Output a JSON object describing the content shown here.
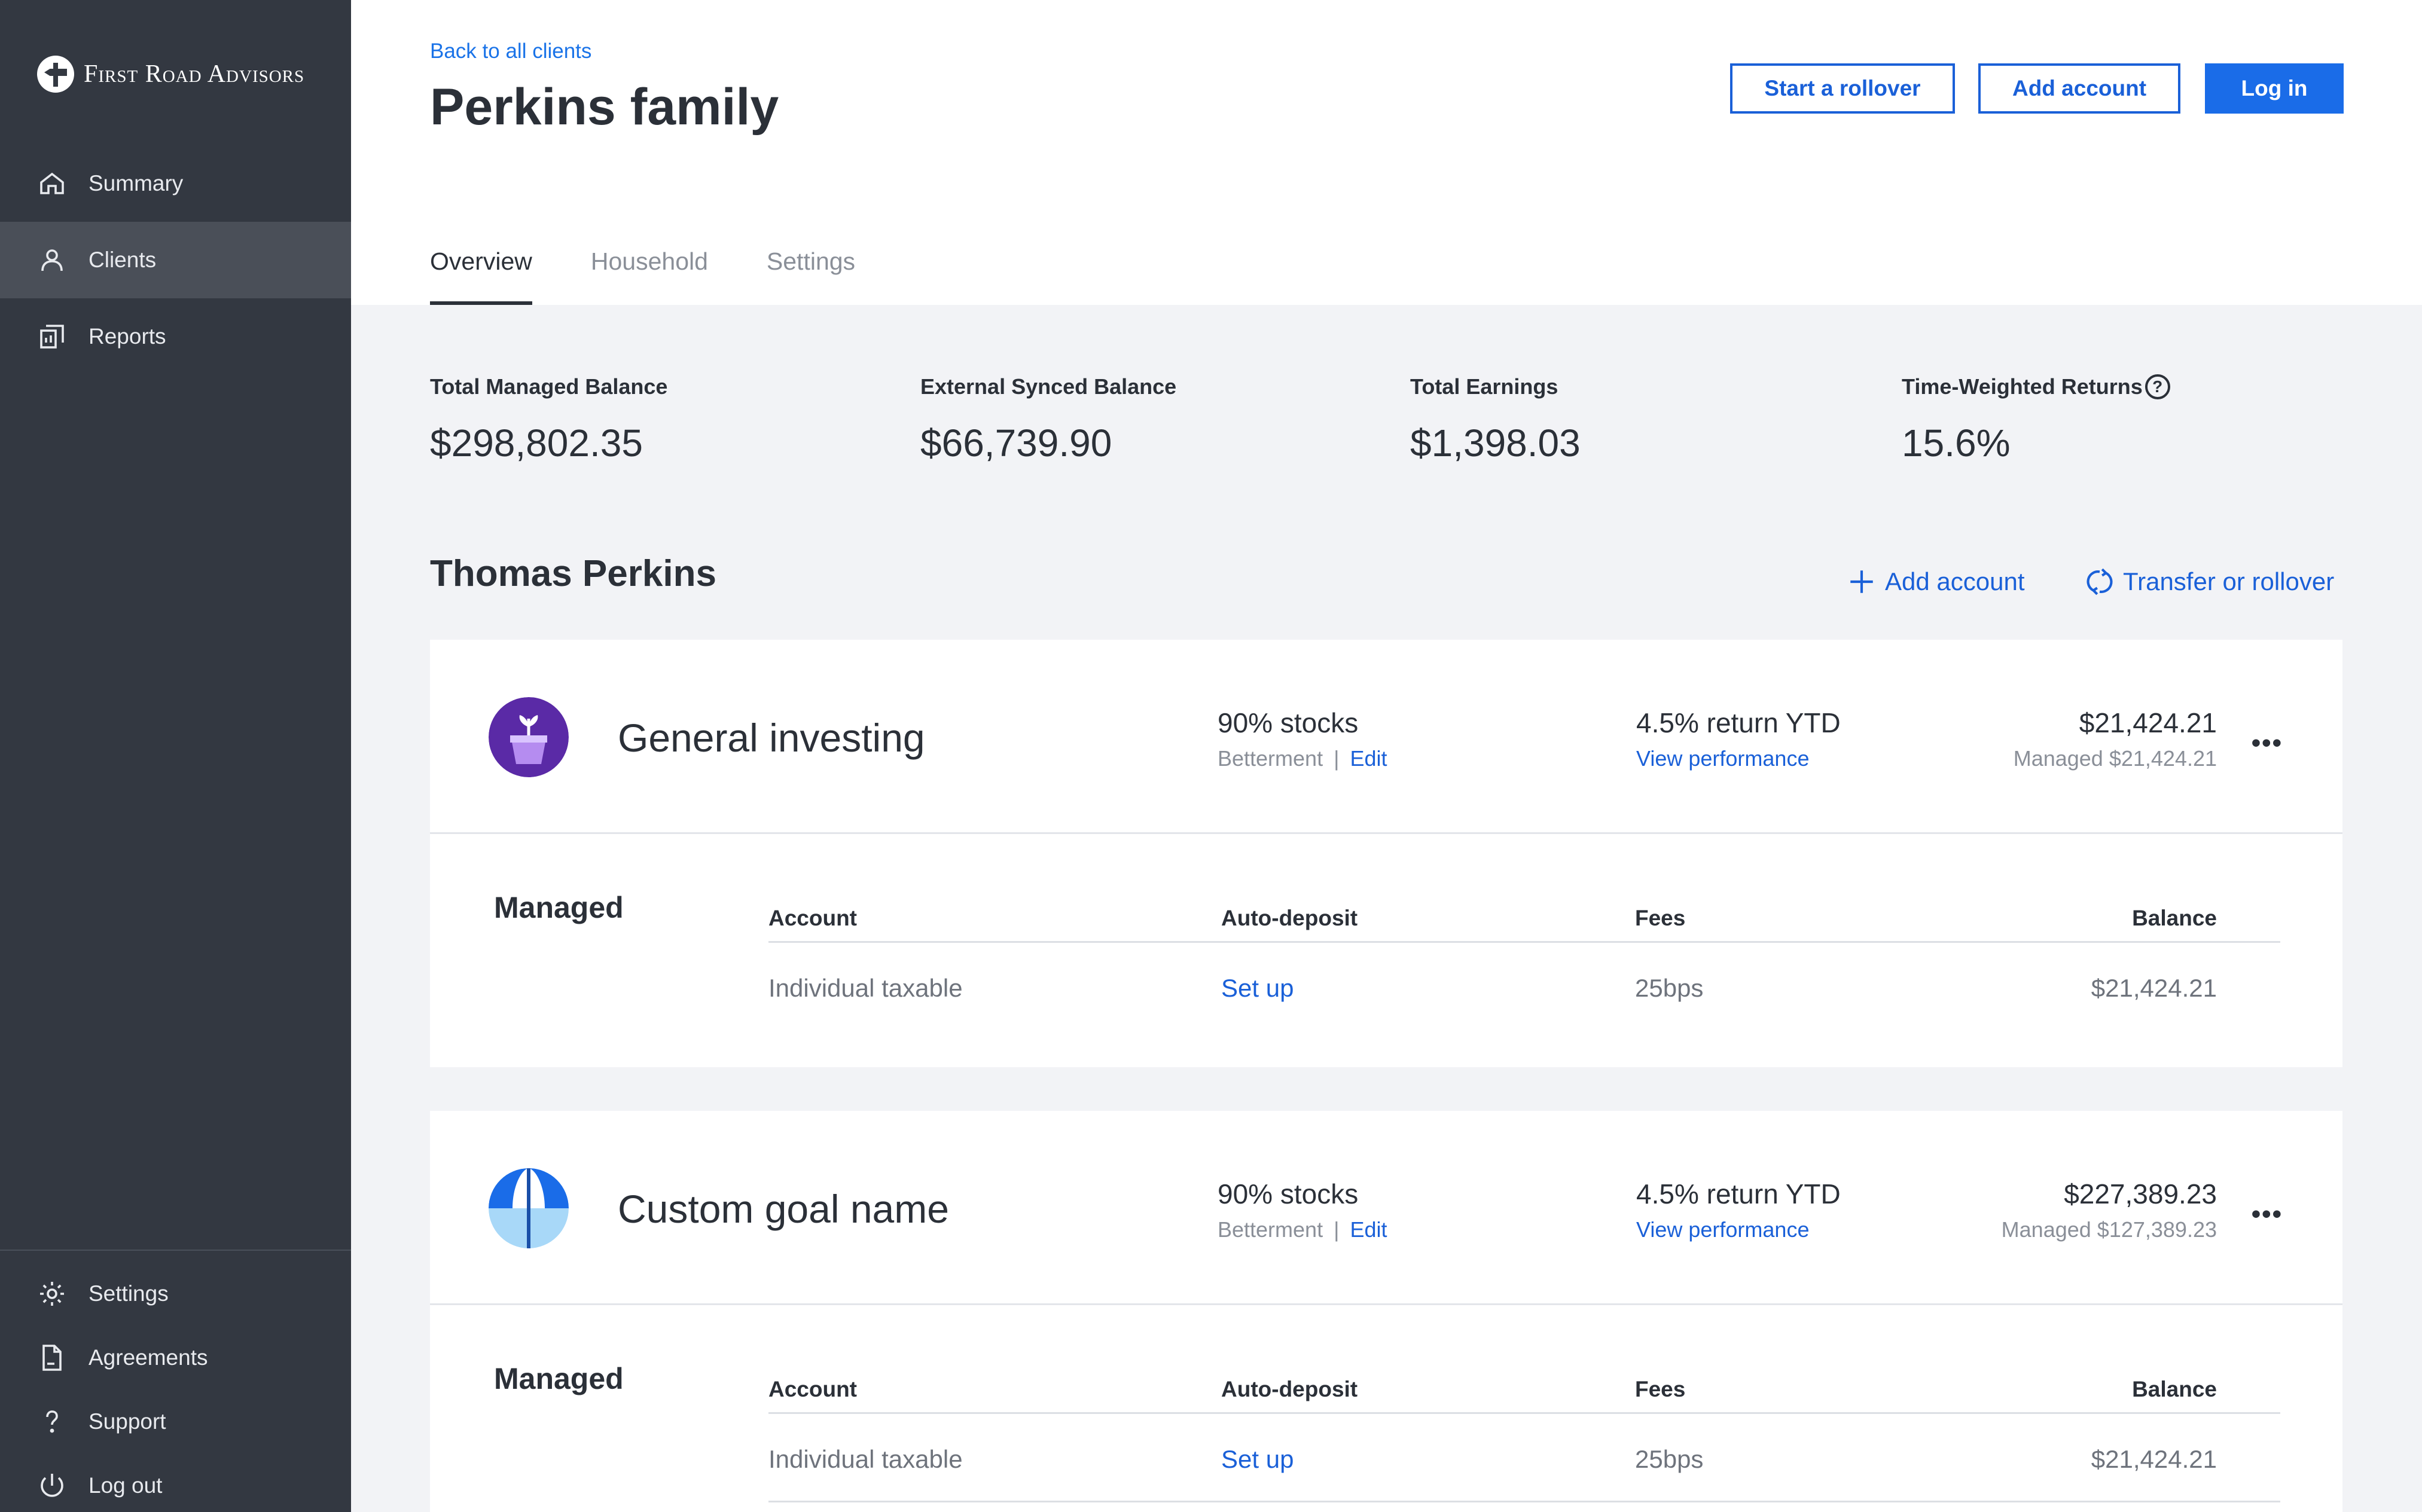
{
  "brand": {
    "name": "First Road Advisors"
  },
  "nav": {
    "top": [
      {
        "label": "Summary",
        "icon": "home-icon"
      },
      {
        "label": "Clients",
        "icon": "person-icon",
        "active": true
      },
      {
        "label": "Reports",
        "icon": "reports-icon"
      }
    ],
    "bottom": [
      {
        "label": "Settings",
        "icon": "gear-icon"
      },
      {
        "label": "Agreements",
        "icon": "document-icon"
      },
      {
        "label": "Support",
        "icon": "question-icon"
      },
      {
        "label": "Log out",
        "icon": "power-icon"
      }
    ]
  },
  "header": {
    "back_link": "Back to all clients",
    "title": "Perkins family",
    "buttons": {
      "rollover": "Start a rollover",
      "add_account": "Add account",
      "login": "Log in"
    },
    "tabs": [
      "Overview",
      "Household",
      "Settings"
    ]
  },
  "stats": [
    {
      "label": "Total Managed Balance",
      "value": "$298,802.35"
    },
    {
      "label": "External Synced Balance",
      "value": "$66,739.90"
    },
    {
      "label": "Total Earnings",
      "value": "$1,398.03"
    },
    {
      "label": "Time-Weighted Returns",
      "value": "15.6%"
    }
  ],
  "person": {
    "name": "Thomas Perkins",
    "add_account": "Add account",
    "transfer": "Transfer or rollover"
  },
  "goals": [
    {
      "name": "General investing",
      "icon": "plant-pot-icon",
      "allocation": "90% stocks",
      "provider": "Betterment",
      "sep": "|",
      "edit": "Edit",
      "return": "4.5% return YTD",
      "performance_link": "View performance",
      "balance": "$21,424.21",
      "managed": "Managed $21,424.21",
      "more": "•••",
      "section_label": "Managed",
      "columns": [
        "Account",
        "Auto-deposit",
        "Fees",
        "Balance"
      ],
      "rows": [
        {
          "account": "Individual taxable",
          "auto_deposit": "Set up",
          "fees": "25bps",
          "balance": "$21,424.21"
        }
      ]
    },
    {
      "name": "Custom goal name",
      "icon": "umbrella-icon",
      "allocation": "90% stocks",
      "provider": "Betterment",
      "sep": "|",
      "edit": "Edit",
      "return": "4.5% return YTD",
      "performance_link": "View performance",
      "balance": "$227,389.23",
      "managed": "Managed $127,389.23",
      "more": "•••",
      "section_label": "Managed",
      "columns": [
        "Account",
        "Auto-deposit",
        "Fees",
        "Balance"
      ],
      "rows": [
        {
          "account": "Individual taxable",
          "auto_deposit": "Set up",
          "fees": "25bps",
          "balance": "$21,424.21"
        }
      ]
    }
  ],
  "colors": {
    "sidebar": "#333841",
    "accent": "#1a6ce8",
    "text": "#2b3038",
    "muted": "#8a8f98",
    "page_bg": "#f2f3f6"
  }
}
